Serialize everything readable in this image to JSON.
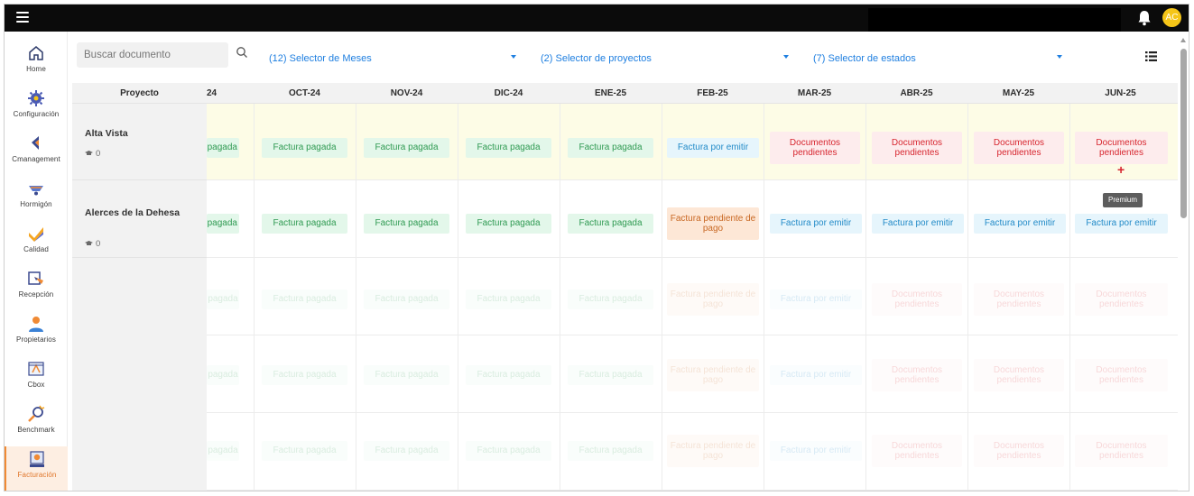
{
  "header": {
    "avatar_initials": "AC"
  },
  "sidebar": {
    "items": [
      {
        "label": "Home",
        "icon": "home-icon"
      },
      {
        "label": "Configuración",
        "icon": "gear-icon"
      },
      {
        "label": "Cmanagement",
        "icon": "flag-icon"
      },
      {
        "label": "Hormigón",
        "icon": "wheelbarrow-icon"
      },
      {
        "label": "Calidad",
        "icon": "check-icon"
      },
      {
        "label": "Recepción",
        "icon": "receive-icon"
      },
      {
        "label": "Propietarios",
        "icon": "person-icon"
      },
      {
        "label": "Cbox",
        "icon": "box-icon"
      },
      {
        "label": "Benchmark",
        "icon": "magnifier-icon"
      },
      {
        "label": "Facturación",
        "icon": "billing-icon"
      }
    ],
    "active": "Facturación"
  },
  "toolbar": {
    "search_placeholder": "Buscar documento",
    "selector_months": "(12) Selector de Meses",
    "selector_projects": "(2) Selector de proyectos",
    "selector_states": "(7) Selector de estados"
  },
  "table": {
    "project_header": "Proyecto",
    "months": [
      "24",
      "OCT-24",
      "NOV-24",
      "DIC-24",
      "ENE-25",
      "FEB-25",
      "MAR-25",
      "ABR-25",
      "MAY-25",
      "JUN-25"
    ],
    "rows": [
      {
        "project": "Alta Vista",
        "count": "0",
        "cells": [
          "pagada",
          "Factura pagada",
          "Factura pagada",
          "Factura pagada",
          "Factura pagada",
          "Factura por emitir",
          "Documentos pendientes",
          "Documentos pendientes",
          "Documentos pendientes",
          "Documentos pendientes"
        ]
      },
      {
        "project": "Alerces de la Dehesa",
        "count": "0",
        "cells": [
          "pagada",
          "Factura pagada",
          "Factura pagada",
          "Factura pagada",
          "Factura pagada",
          "Factura pendiente de pago",
          "Factura por emitir",
          "Factura por emitir",
          "Factura por emitir",
          "Factura por emitir"
        ]
      }
    ],
    "placeholder_cells": [
      "pagada",
      "Factura pagada",
      "Factura pagada",
      "Factura pagada",
      "Factura pagada",
      "Factura pendiente de pago",
      "Factura por emitir",
      "Documentos pendientes",
      "Documentos pendientes",
      "Documentos pendientes"
    ],
    "add_symbol": "+",
    "tooltip": "Premium"
  },
  "colors": {
    "pagada_bg": "#e3f7ea",
    "pagada_text": "#2f9a52",
    "emitir_bg": "#e6f5fc",
    "emitir_text": "#238bc8",
    "pendientes_bg": "#fdeced",
    "pendientes_text": "#d7262f",
    "pendpago_bg": "#fde7d6",
    "pendpago_text": "#c86823",
    "accent": "#1f7fe0",
    "active_nav": "#f08a34"
  }
}
